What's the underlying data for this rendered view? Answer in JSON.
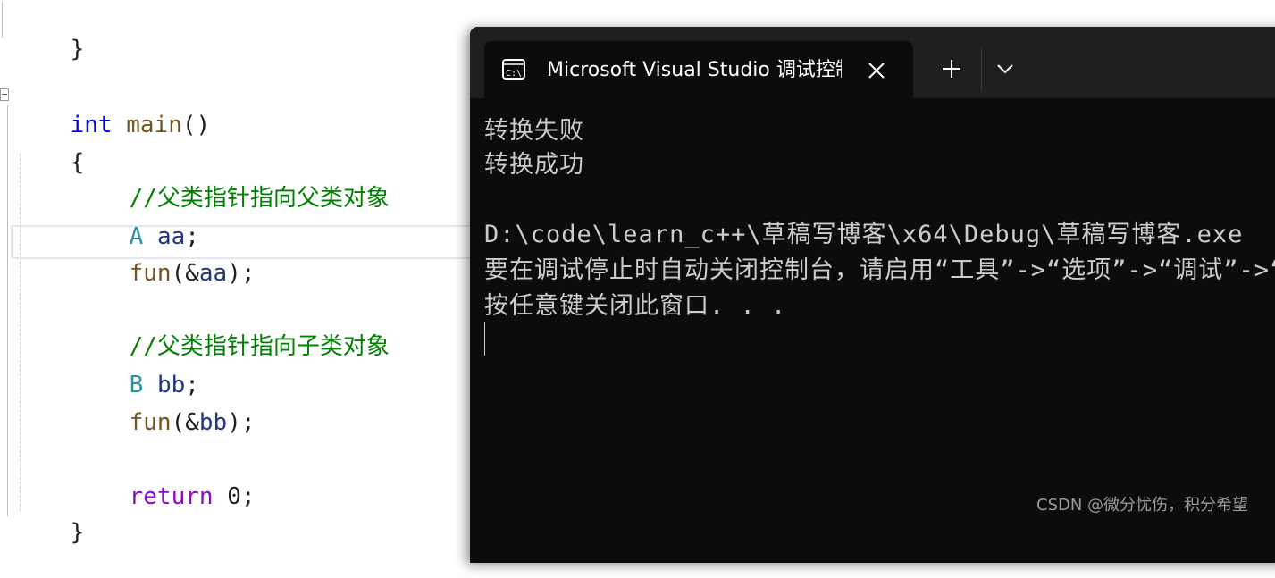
{
  "editor": {
    "lines": {
      "closing_brace_top": "}",
      "main_kw": "int",
      "main_fn": "main",
      "main_parens": "()",
      "open_brace": "{",
      "comment1": "//父类指针指向父类对象",
      "decl_a_type": "A",
      "decl_a_var": "aa",
      "decl_a_semi": ";",
      "call1_fn": "fun",
      "call1_open": "(&",
      "call1_arg": "aa",
      "call1_close": ");",
      "comment2": "//父类指针指向子类对象",
      "decl_b_type": "B",
      "decl_b_var": "bb",
      "decl_b_semi": ";",
      "call2_fn": "fun",
      "call2_open": "(&",
      "call2_arg": "bb",
      "call2_close": ");",
      "return_kw": "return",
      "return_val": "0;",
      "close_brace": "}"
    }
  },
  "terminal": {
    "tab_title": "Microsoft Visual Studio 调试控制台",
    "new_tab_label": "+",
    "output": [
      "转换失败",
      "转换成功",
      "",
      "D:\\code\\learn_c++\\草稿写博客\\x64\\Debug\\草稿写博客.exe",
      "要在调试停止时自动关闭控制台，请启用“工具”->“选项”->“调试”->“调试停止时自动关闭控制台”。",
      "按任意键关闭此窗口. . ."
    ]
  },
  "watermark": "CSDN @微分忧伤，积分希望",
  "colors": {
    "keyword": "#0000ff",
    "return_keyword": "#8f08c4",
    "function": "#74531f",
    "type": "#2b91af",
    "variable": "#1f377f",
    "comment": "#008000",
    "terminal_bg": "#0c0c0c",
    "terminal_text": "#cccccc"
  },
  "icons": [
    "terminal-app-icon",
    "close-icon",
    "plus-icon",
    "chevron-down-icon",
    "collapse-icon"
  ]
}
